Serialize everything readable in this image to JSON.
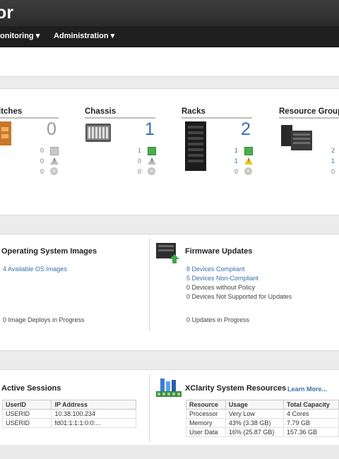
{
  "header": {
    "brand_suffix": "or",
    "nav": [
      {
        "label": "onitoring ▾"
      },
      {
        "label": "Administration ▾"
      }
    ]
  },
  "summary": {
    "switches": {
      "title": "itches",
      "total": "0",
      "ok": "0",
      "warn": "0",
      "err": "0"
    },
    "chassis": {
      "title": "Chassis",
      "total": "1",
      "ok": "1",
      "warn": "0",
      "err": "0"
    },
    "racks": {
      "title": "Racks",
      "total": "2",
      "ok": "1",
      "warn": "1",
      "err": "0"
    },
    "resource_groups": {
      "title": "Resource Group",
      "ok": "2",
      "warn": "1",
      "err": "0"
    }
  },
  "os_images": {
    "title": "Operating System Images",
    "available": "4 Available OS Images",
    "deploys": "0 Image Deploys in Progress"
  },
  "firmware": {
    "title": "Firmware Updates",
    "compliant": "8 Devices Compliant",
    "non_compliant": "5 Devices Non-Compliant",
    "no_policy": "0 Devices without Policy",
    "not_supported": "0 Devices Not Supported for Updates",
    "in_progress": "0 Updates in Progress"
  },
  "sessions": {
    "title": "Active Sessions",
    "headers": [
      "UserID",
      "IP Address"
    ],
    "rows": [
      [
        "USERID",
        "10.38.100.234"
      ],
      [
        "USERID",
        "fd01:1:1:1:0:0:..."
      ]
    ]
  },
  "resources": {
    "title": "XClarity System Resources",
    "learn_more": "Learn More...",
    "headers": [
      "Resource",
      "Usage",
      "Total Capacity"
    ],
    "rows": [
      [
        "Processor",
        "Very Low",
        "4 Cores"
      ],
      [
        "Memory",
        "43% (3.38 GB)",
        "7.79 GB"
      ],
      [
        "User Data",
        "16% (25.87 GB)",
        "157.36 GB"
      ]
    ],
    "colors": {
      "very_low": "#3a9a3a"
    }
  }
}
